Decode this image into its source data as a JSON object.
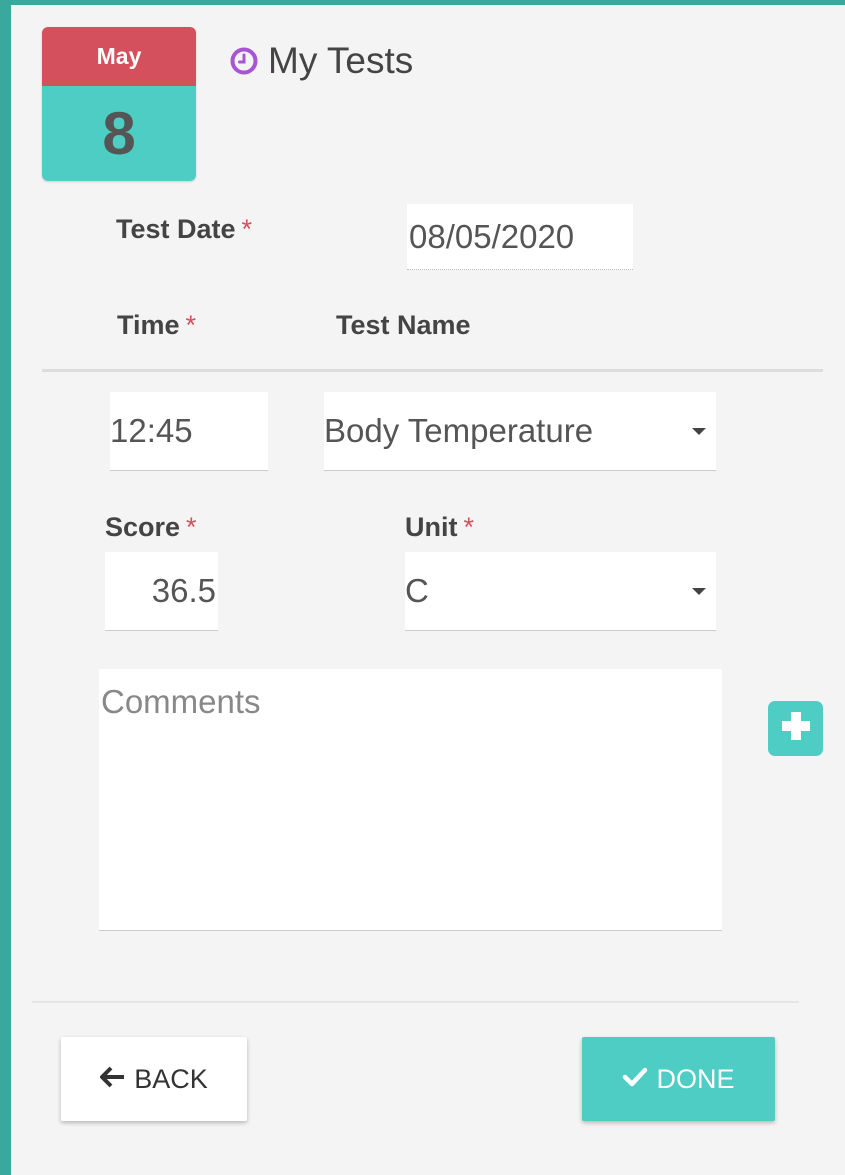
{
  "calendar": {
    "month": "May",
    "day": "8"
  },
  "page": {
    "title": "My Tests",
    "title_icon": "clock-icon"
  },
  "required_marker": "*",
  "test_date": {
    "label": "Test Date",
    "value": "08/05/2020"
  },
  "time": {
    "label": "Time",
    "value": "12:45"
  },
  "test_name": {
    "label": "Test Name",
    "value": "Body Temperature"
  },
  "score": {
    "label": "Score",
    "value": "36.5"
  },
  "unit": {
    "label": "Unit",
    "value": "C"
  },
  "comments": {
    "placeholder": "Comments",
    "value": ""
  },
  "add_button": {
    "icon": "plus-icon"
  },
  "buttons": {
    "back": "BACK",
    "done": "DONE"
  },
  "colors": {
    "accent": "#4ecdc4",
    "calendar_header": "#d4505c",
    "border": "#3aa89d",
    "required": "#d4505c",
    "clock_icon": "#a855d4"
  }
}
